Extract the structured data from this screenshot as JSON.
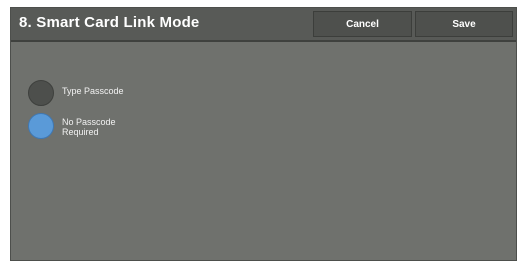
{
  "header": {
    "title": "8. Smart Card Link Mode",
    "cancel_label": "Cancel",
    "save_label": "Save"
  },
  "options": [
    {
      "label": "Type Passcode",
      "selected": false
    },
    {
      "label": "No Passcode\nRequired",
      "selected": true
    }
  ],
  "colors": {
    "panel": "#6f716d",
    "header": "#585a57",
    "selected_radio": "#5a9ad8",
    "unselected_radio": "#4d4f4c"
  }
}
